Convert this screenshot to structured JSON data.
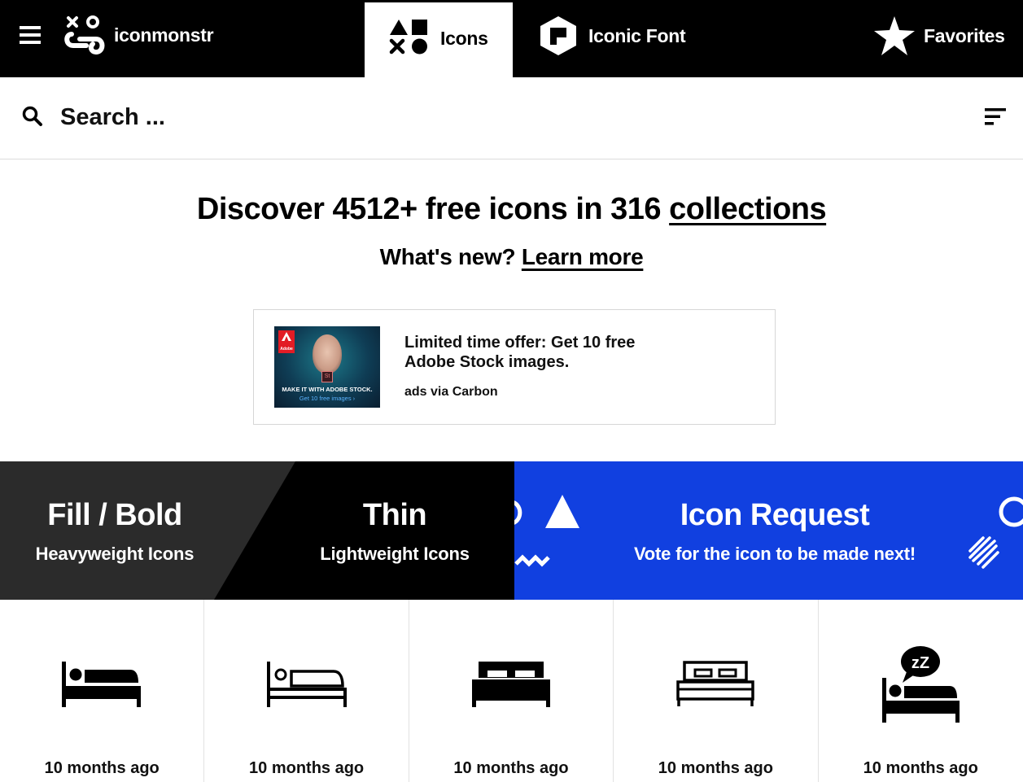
{
  "nav": {
    "logo_text": "iconmonstr",
    "tabs": [
      {
        "label": "Icons",
        "icon": "shapes-icon"
      },
      {
        "label": "Iconic Font",
        "icon": "iconic-font-icon"
      },
      {
        "label": "Favorites",
        "icon": "star-icon"
      }
    ]
  },
  "search": {
    "placeholder": "Search ..."
  },
  "hero": {
    "title_prefix": "Discover 4512+ free icons in 316",
    "title_link": "collections",
    "sub_prefix": "What's new?",
    "sub_link": "Learn more"
  },
  "ad": {
    "logo": "Adobe",
    "badge": "St",
    "caption": "MAKE IT WITH ADOBE STOCK.",
    "cta": "Get 10 free images ›",
    "text": "Limited time offer: Get 10 free Adobe Stock images.",
    "via": "ads via Carbon"
  },
  "banners": {
    "fill": {
      "title": "Fill / Bold",
      "subtitle": "Heavyweight Icons"
    },
    "thin": {
      "title": "Thin",
      "subtitle": "Lightweight Icons"
    },
    "request": {
      "title": "Icon Request",
      "subtitle": "Vote for the icon to be made next!"
    }
  },
  "grid": [
    {
      "icon": "bed-person-fill-icon",
      "time": "10 months ago"
    },
    {
      "icon": "bed-person-thin-icon",
      "time": "10 months ago"
    },
    {
      "icon": "double-bed-fill-icon",
      "time": "10 months ago"
    },
    {
      "icon": "double-bed-thin-icon",
      "time": "10 months ago"
    },
    {
      "icon": "sleeping-bed-icon",
      "time": "10 months ago",
      "badge": "zZ"
    }
  ],
  "colors": {
    "nav_bg": "#000000",
    "fill_banner": "#2b2b2b",
    "thin_banner": "#000000",
    "request_banner": "#1140e0"
  }
}
